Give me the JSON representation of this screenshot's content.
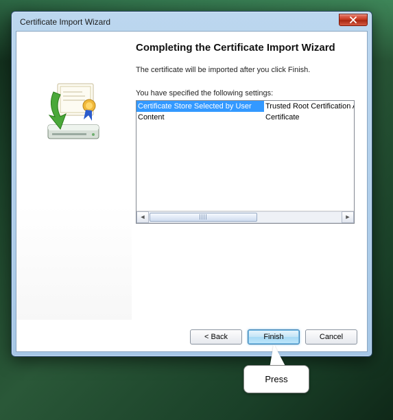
{
  "window": {
    "title": "Certificate Import Wizard"
  },
  "wizard": {
    "heading": "Completing the Certificate Import Wizard",
    "description": "The certificate will be imported after you click Finish.",
    "settings_label": "You have specified the following settings:",
    "rows": [
      {
        "name": "Certificate Store Selected by User",
        "value": "Trusted Root Certification Authorities"
      },
      {
        "name": "Content",
        "value": "Certificate"
      }
    ]
  },
  "buttons": {
    "back": "< Back",
    "finish": "Finish",
    "cancel": "Cancel"
  },
  "callout": {
    "text": "Press"
  }
}
